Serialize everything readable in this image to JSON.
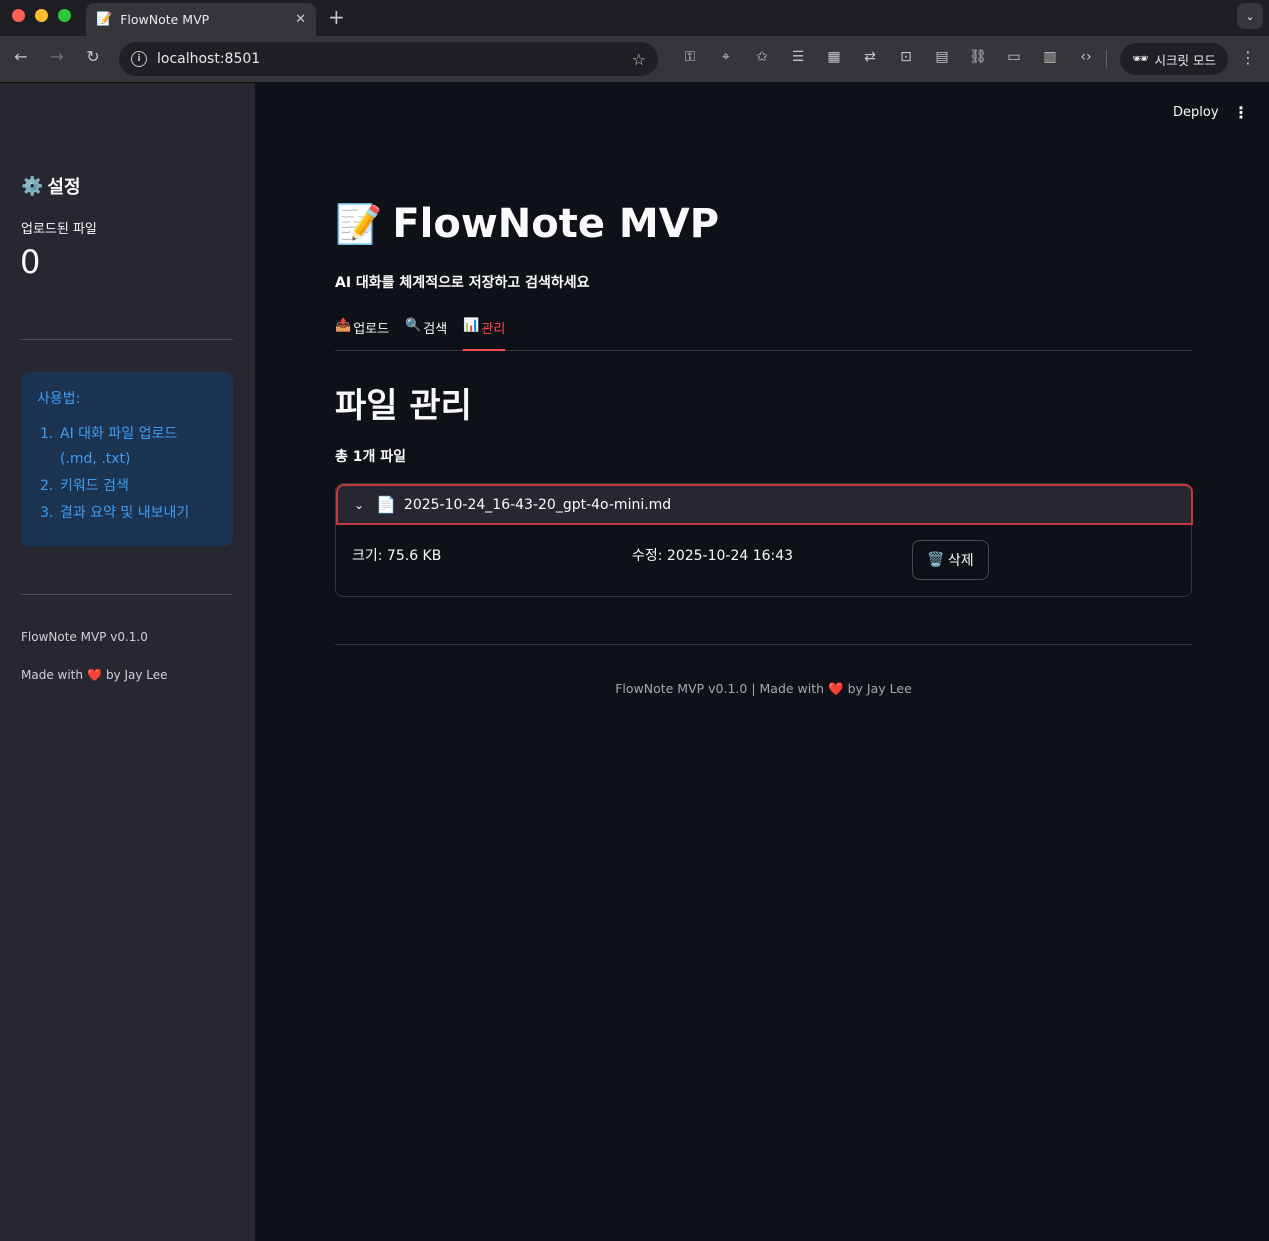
{
  "browser": {
    "tab_favicon": "📝",
    "tab_title": "FlowNote MVP",
    "tab_close": "✕",
    "new_tab": "+",
    "tab_menu": "⌄",
    "url": "localhost:8501",
    "incognito_label": "시크릿 모드",
    "icons": {
      "back": "←",
      "forward": "→",
      "reload": "↻",
      "info": "i",
      "star": "☆",
      "menu": "⋮",
      "incognito": "🕶"
    },
    "extensions": [
      "⚿",
      "⌖",
      "✩",
      "☰",
      "▦",
      "⇄",
      "⊡",
      "▤",
      "⛓",
      "▭",
      "▥",
      "‹›"
    ]
  },
  "sidebar": {
    "title_icon": "⚙️",
    "title": "설정",
    "metric_label": "업로드된 파일",
    "metric_value": "0",
    "info_title": "사용법:",
    "info_items": [
      {
        "num": "1.",
        "text": "AI 대화 파일 업로드 (.md, .txt)"
      },
      {
        "num": "2.",
        "text": "키워드 검색"
      },
      {
        "num": "3.",
        "text": "결과 요약 및 내보내기"
      }
    ],
    "version": "FlowNote MVP v0.1.0",
    "made_with": "Made with",
    "heart": "❤️",
    "by": "by Jay Lee"
  },
  "header": {
    "deploy_label": "Deploy",
    "menu_icon": "⋮"
  },
  "main": {
    "title_emoji": "📝",
    "title": "FlowNote MVP",
    "subtitle": "AI 대화를 체계적으로 저장하고 검색하세요",
    "tabs": [
      {
        "icon": "📤",
        "label": "업로드",
        "active": false
      },
      {
        "icon": "🔍",
        "label": "검색",
        "active": false
      },
      {
        "icon": "📊",
        "label": "관리",
        "active": true
      }
    ],
    "section_title": "파일 관리",
    "file_count": "총 1개 파일",
    "file": {
      "chevron": "⌄",
      "icon": "📄",
      "name": "2025-10-24_16-43-20_gpt-4o-mini.md",
      "size": "크기: 75.6 KB",
      "modified": "수정: 2025-10-24 16:43",
      "delete_icon": "🗑️",
      "delete_label": "삭제"
    },
    "footer_left": "FlowNote MVP v0.1.0 | Made with",
    "footer_heart": "❤️",
    "footer_right": "by Jay Lee"
  },
  "colors": {
    "accent": "#ff4b4b",
    "info_bg": "#1c3452",
    "info_text": "#3d9df3",
    "sidebar_bg": "#262730",
    "main_bg": "#0e1117"
  }
}
